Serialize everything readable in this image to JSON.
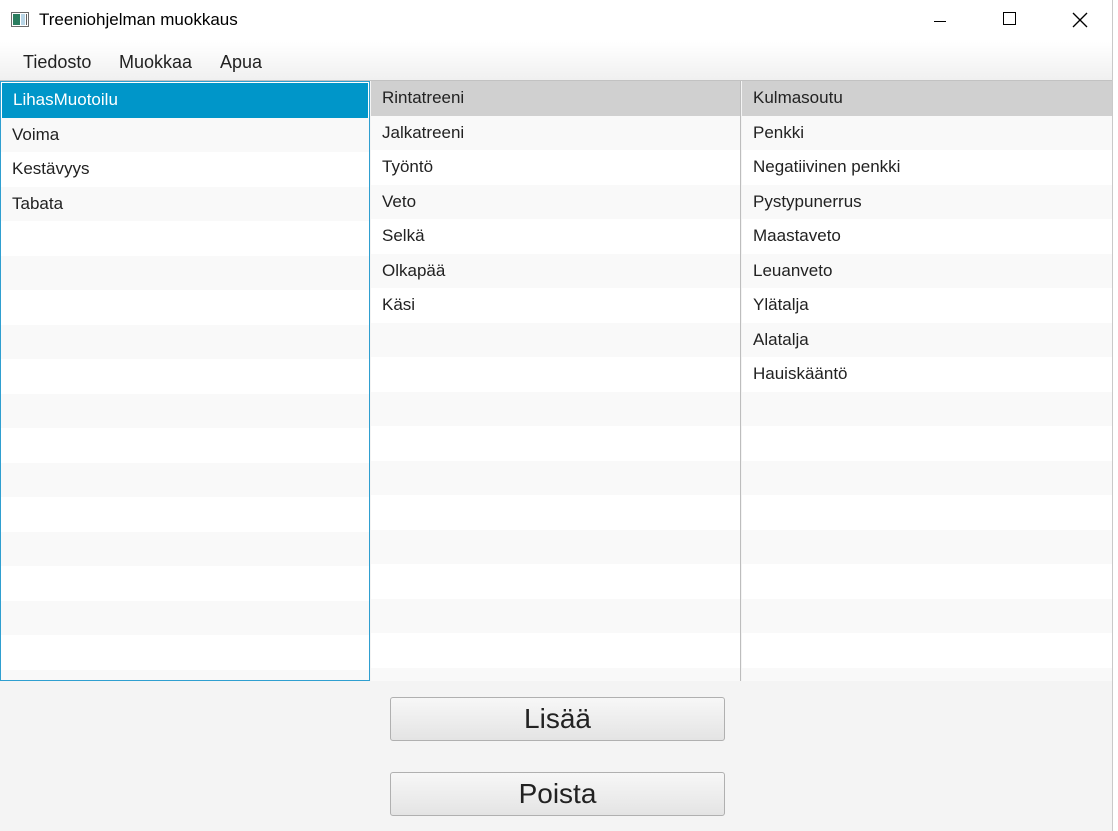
{
  "window": {
    "title": "Treeniohjelman muokkaus"
  },
  "menu": {
    "items": [
      "Tiedosto",
      "Muokkaa",
      "Apua"
    ]
  },
  "lists": {
    "programs": {
      "items": [
        "LihasMuotoilu",
        "Voima",
        "Kestävyys",
        "Tabata"
      ],
      "selected": "LihasMuotoilu"
    },
    "workouts": {
      "items": [
        "Rintatreeni",
        "Jalkatreeni",
        "Työntö",
        "Veto",
        "Selkä",
        "Olkapää",
        "Käsi"
      ],
      "selected": "Rintatreeni"
    },
    "exercises": {
      "items": [
        "Kulmasoutu",
        "Penkki",
        "Negatiivinen penkki",
        "Pystypunerrus",
        "Maastaveto",
        "Leuanveto",
        "Ylätalja",
        "Alatalja",
        "Hauiskääntö"
      ],
      "selected": "Kulmasoutu"
    }
  },
  "buttons": {
    "add": "Lisää",
    "remove": "Poista"
  },
  "colors": {
    "selection_focused": "#0096c9",
    "selection_unfocused": "#d0d0d0",
    "focus_border": "#2f9fd0"
  }
}
